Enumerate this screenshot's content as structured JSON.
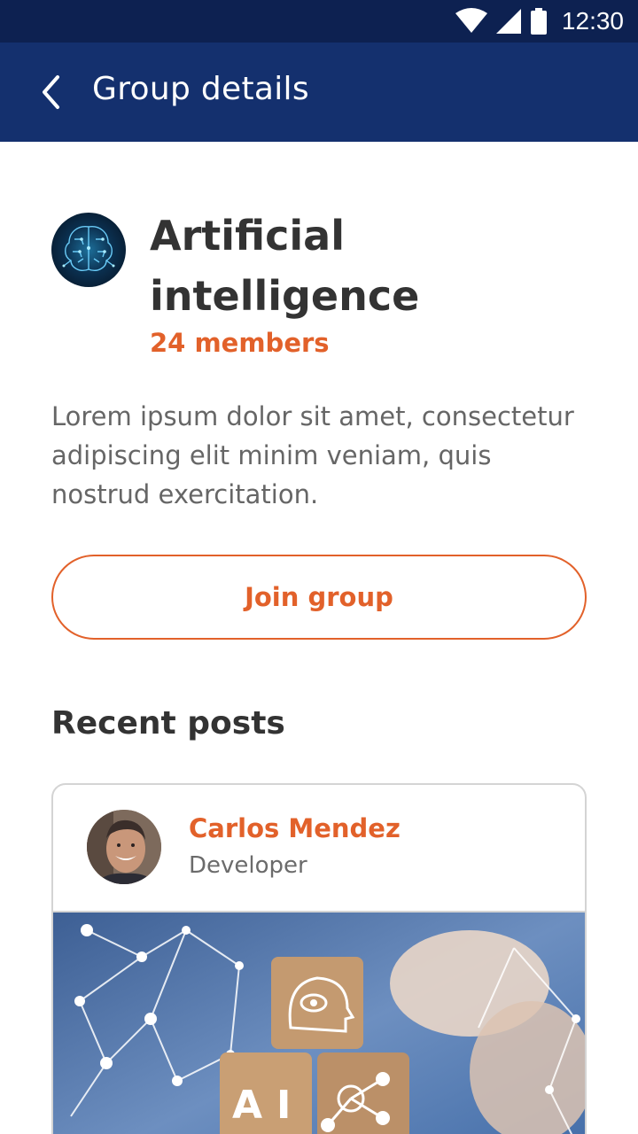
{
  "status_bar": {
    "time": "12:30",
    "icons": [
      "wifi-icon",
      "cellular-signal-icon",
      "battery-icon"
    ]
  },
  "app_bar": {
    "title": "Group details",
    "back_icon": "chevron-left-icon"
  },
  "group": {
    "name": "Artificial intelligence",
    "members": "24 members",
    "description": "Lorem ipsum dolor sit amet, consectetur adipiscing elit minim veniam, quis nostrud exercitation.",
    "join_label": "Join group"
  },
  "recent_posts": {
    "title": "Recent posts",
    "posts": [
      {
        "author": "Carlos Mendez",
        "role": "Developer"
      }
    ]
  },
  "colors": {
    "status_bar": "#0d2151",
    "app_bar": "#14306e",
    "accent": "#e2612a",
    "text_dark": "#333333",
    "text_muted": "#666666",
    "card_border": "#d4d4d4"
  }
}
